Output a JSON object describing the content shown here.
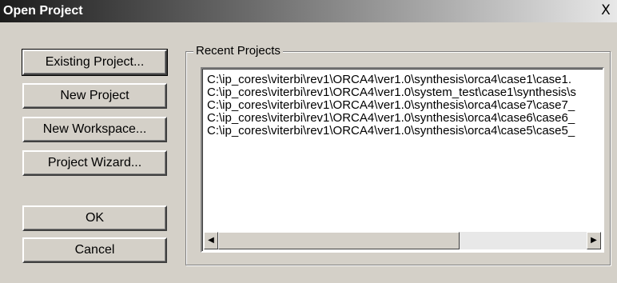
{
  "window": {
    "title": "Open Project",
    "close_glyph": "X"
  },
  "buttons": {
    "existing_project": "Existing Project...",
    "new_project": "New Project",
    "new_workspace": "New Workspace...",
    "project_wizard": "Project Wizard...",
    "ok": "OK",
    "cancel": "Cancel"
  },
  "recent": {
    "legend": "Recent Projects",
    "items": [
      "C:\\ip_cores\\viterbi\\rev1\\ORCA4\\ver1.0\\synthesis\\orca4\\case1\\case1.",
      "C:\\ip_cores\\viterbi\\rev1\\ORCA4\\ver1.0\\system_test\\case1\\synthesis\\s",
      "C:\\ip_cores\\viterbi\\rev1\\ORCA4\\ver1.0\\synthesis\\orca4\\case7\\case7_",
      "C:\\ip_cores\\viterbi\\rev1\\ORCA4\\ver1.0\\synthesis\\orca4\\case6\\case6_",
      "C:\\ip_cores\\viterbi\\rev1\\ORCA4\\ver1.0\\synthesis\\orca4\\case5\\case5_"
    ]
  },
  "scrollbar": {
    "left_arrow": "◀",
    "right_arrow": "▶"
  },
  "colors": {
    "face": "#d4d0c8",
    "title_start": "#1c1c1c",
    "title_end": "#e8e8e8"
  }
}
